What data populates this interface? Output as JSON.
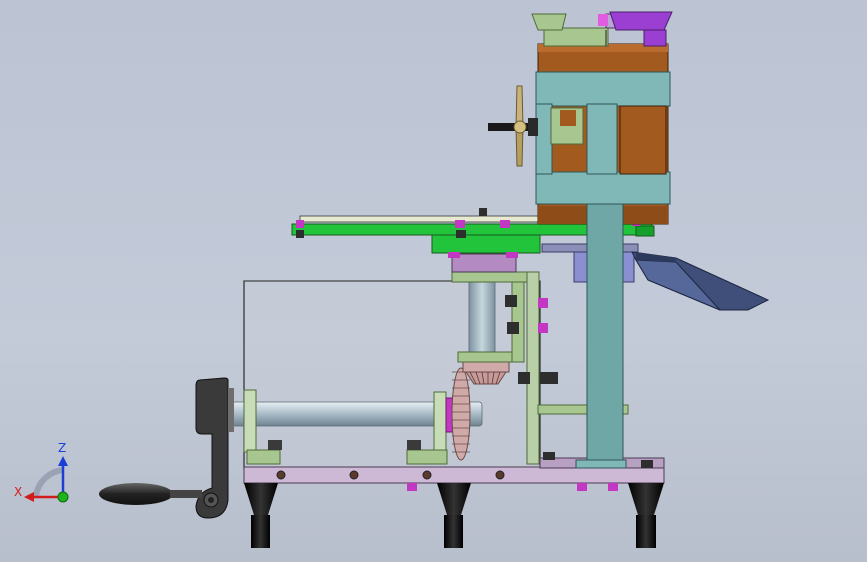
{
  "viewport": {
    "background_color": "#c0c7d5"
  },
  "axis_triad": {
    "z_label": "Z",
    "x_label": "X",
    "z_color": "#1a3fd6",
    "x_color": "#d11c1c",
    "y_color": "#1bb51b"
  },
  "model": {
    "hopper_body_color": "#a35a1f",
    "frame_color": "#7fb8b7",
    "platform_color": "#21c43b",
    "base_color": "#cdb8d6",
    "chute_color": "#3f4f7a",
    "foot_color": "#1a1a1a",
    "handle_color": "#2b2b2b",
    "shaft_color": "#b8c8d2",
    "gear_color": "#b89090",
    "bracket_color": "#a8c690",
    "top_bracket_color": "#9b3fd3"
  }
}
